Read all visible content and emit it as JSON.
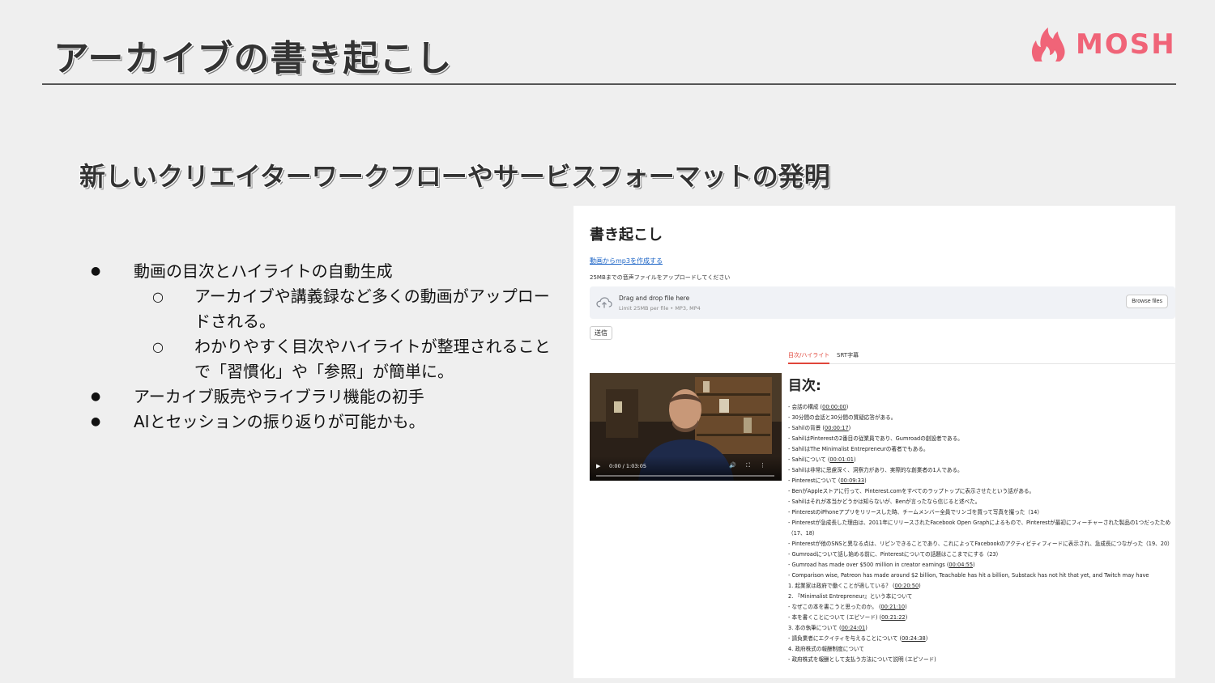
{
  "slide": {
    "title": "アーカイブの書き起こし",
    "logo_text": "MOSH",
    "subtitle": "新しいクリエイターワークフローやサービスフォーマットの発明"
  },
  "bullets": [
    {
      "level": 1,
      "marker": "●",
      "text": "動画の目次とハイライトの自動生成"
    },
    {
      "level": 2,
      "marker": "○",
      "text": "アーカイブや講義録など多くの動画がアップロードされる。"
    },
    {
      "level": 2,
      "marker": "○",
      "text": "わかりやすく目次やハイライトが整理されることで「習慣化」や「参照」が簡単に。"
    },
    {
      "level": 1,
      "marker": "●",
      "text": "アーカイブ販売やライブラリ機能の初手"
    },
    {
      "level": 1,
      "marker": "●",
      "text": "AIとセッションの振り返りが可能かも。"
    }
  ],
  "screenshot": {
    "title": "書き起こし",
    "mp3_link": "動画からmp3を作成する",
    "upload_label": "25MBまでの音声ファイルをアップロードしてください",
    "drop_main": "Drag and drop file here",
    "drop_sub": "Limit 25MB per file • MP3, MP4",
    "browse_button": "Browse files",
    "send_button": "送信",
    "tabs": [
      {
        "label": "目次/ハイライト",
        "active": true
      },
      {
        "label": "SRT字幕",
        "active": false
      }
    ],
    "video": {
      "time": "0:00 / 1:03:05"
    },
    "toc_heading": "目次:",
    "toc_items": [
      {
        "text": "- 会話の構成 (",
        "ts": "00:00:00",
        "end": ")"
      },
      {
        "text": "- 30分間の会話と30分間の質疑応答がある。",
        "ts": "",
        "end": ""
      },
      {
        "text": "- Sahilの背景 (",
        "ts": "00:00:17",
        "end": ")"
      },
      {
        "text": "- SahilはPinterestの2番目の従業員であり、Gumroadの創設者である。",
        "ts": "",
        "end": ""
      },
      {
        "text": "- SahilはThe Minimalist Entrepreneurの著者でもある。",
        "ts": "",
        "end": ""
      },
      {
        "text": "- Sahilについて (",
        "ts": "00:01:01",
        "end": ")"
      },
      {
        "text": "- Sahilは非常に思慮深く、洞察力があり、実際的な創業者の1人である。",
        "ts": "",
        "end": ""
      },
      {
        "text": "- Pinterestについて (",
        "ts": "00:09:33",
        "end": ")"
      },
      {
        "text": "- BenがAppleストアに行って、Pinterest.comをすべてのラップトップに表示させたという話がある。",
        "ts": "",
        "end": ""
      },
      {
        "text": "- Sahilはそれが本当かどうかは知らないが、Benが言ったなら信じると述べた。",
        "ts": "",
        "end": ""
      },
      {
        "text": "- PinterestのiPhoneアプリをリリースした時、チームメンバー全員でリンゴを買って写真を撮った（14）",
        "ts": "",
        "end": ""
      },
      {
        "text": "- Pinterestが急成長した理由は、2011年にリリースされたFacebook Open Graphによるもので、Pinterestが最初にフィーチャーされた製品の1つだったため（17、18）",
        "ts": "",
        "end": "",
        "wrap": true
      },
      {
        "text": "- Pinterestが他のSNSと異なる点は、リピンできることであり、これによってFacebookのアクティビティフィードに表示され、急成長につながった（19、20）",
        "ts": "",
        "end": "",
        "wrap": true
      },
      {
        "text": "- Gumroadについて話し始める前に、Pinterestについての話題はここまでにする（23）",
        "ts": "",
        "end": ""
      },
      {
        "text": "- Gumroad has made over $500 million in creator earnings (",
        "ts": "00:04:55",
        "end": ")"
      },
      {
        "text": "- Comparison wise, Patreon has made around $2 billion, Teachable has hit a billion, Substack has not hit that yet, and Twitch may have",
        "ts": "",
        "end": ""
      },
      {
        "text": "1. 起業家は政府で働くことが適している？ (",
        "ts": "00:20:50",
        "end": ")"
      },
      {
        "text": "2. 『Minimalist Entrepreneur』という本について",
        "ts": "",
        "end": ""
      },
      {
        "text": "- なぜこの本を書こうと思ったのか。 (",
        "ts": "00:21:10",
        "end": ")"
      },
      {
        "text": "- 本を書くことについて (エピソード) (",
        "ts": "00:21:22",
        "end": ")"
      },
      {
        "text": "3. 本の執筆について (",
        "ts": "00:24:01",
        "end": ")"
      },
      {
        "text": "- 請負業者にエクイティを与えることについて (",
        "ts": "00:24:38",
        "end": ")"
      },
      {
        "text": "4. 政府株式の報酬制度について",
        "ts": "",
        "end": ""
      },
      {
        "text": "- 政府株式を報酬として支払う方法について説明 (エピソード)",
        "ts": "",
        "end": ""
      }
    ]
  },
  "colors": {
    "background": "#efefef",
    "brand": "#f06478",
    "tab_active": "#e0453a",
    "link": "#1a63c6"
  }
}
